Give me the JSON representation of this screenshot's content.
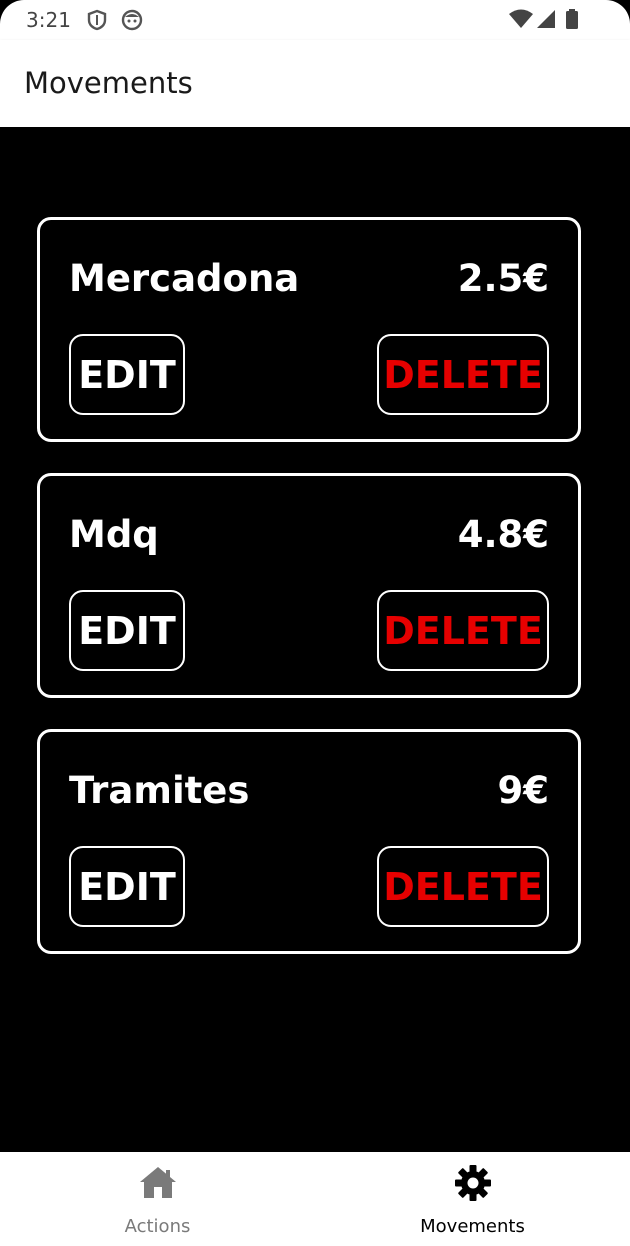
{
  "status_bar": {
    "time": "3:21",
    "icons": [
      "shield-icon",
      "face-icon",
      "wifi-icon",
      "signal-icon",
      "battery-icon"
    ]
  },
  "app_bar": {
    "title": "Movements"
  },
  "movements": [
    {
      "name": "Mercadona",
      "amount": "2.5€",
      "edit_label": "EDIT",
      "delete_label": "DELETE"
    },
    {
      "name": "Mdq",
      "amount": "4.8€",
      "edit_label": "EDIT",
      "delete_label": "DELETE"
    },
    {
      "name": "Tramites",
      "amount": "9€",
      "edit_label": "EDIT",
      "delete_label": "DELETE"
    }
  ],
  "bottom_nav": {
    "items": [
      {
        "label": "Actions",
        "icon": "home-icon",
        "active": false
      },
      {
        "label": "Movements",
        "icon": "gear-icon",
        "active": true
      }
    ]
  },
  "colors": {
    "background": "#000000",
    "surface": "#ffffff",
    "delete": "#e60000",
    "nav_active": "#000000",
    "nav_inactive": "#7a7a7a"
  }
}
